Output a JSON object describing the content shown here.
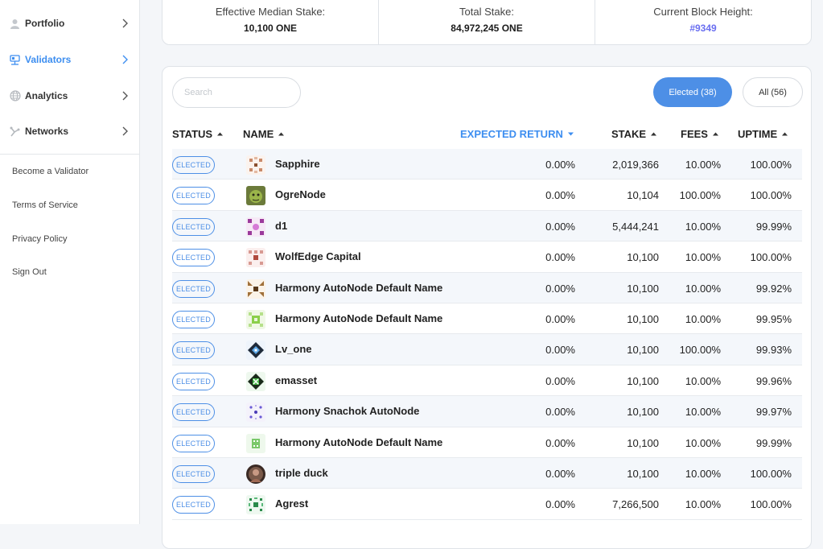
{
  "sidebar": {
    "nav": [
      {
        "label": "Portfolio",
        "icon": "user-icon",
        "active": false
      },
      {
        "label": "Validators",
        "icon": "validators-icon",
        "active": true
      },
      {
        "label": "Analytics",
        "icon": "globe-icon",
        "active": false
      },
      {
        "label": "Networks",
        "icon": "network-icon",
        "active": false
      }
    ],
    "links": [
      "Become a Validator",
      "Terms of Service",
      "Privacy Policy",
      "Sign Out"
    ]
  },
  "stats": {
    "median_label": "Effective Median Stake:",
    "median_value": "10,100 ONE",
    "total_label": "Total Stake:",
    "total_value": "84,972,245 ONE",
    "block_label": "Current Block Height:",
    "block_value": "#9349"
  },
  "table": {
    "search_placeholder": "Search",
    "filter_elected": "Elected (38)",
    "filter_all": "All (56)",
    "columns": {
      "status": "STATUS",
      "name": "NAME",
      "expected_return": "EXPECTED RETURN",
      "stake": "STAKE",
      "fees": "FEES",
      "uptime": "UPTIME"
    },
    "rows": [
      {
        "status": "ELECTED",
        "name": "Sapphire",
        "ret": "0.00%",
        "stake": "2,019,366",
        "fees": "10.00%",
        "uptime": "100.00%"
      },
      {
        "status": "ELECTED",
        "name": "OgreNode",
        "ret": "0.00%",
        "stake": "10,104",
        "fees": "100.00%",
        "uptime": "100.00%"
      },
      {
        "status": "ELECTED",
        "name": "d1",
        "ret": "0.00%",
        "stake": "5,444,241",
        "fees": "10.00%",
        "uptime": "99.99%"
      },
      {
        "status": "ELECTED",
        "name": "WolfEdge Capital",
        "ret": "0.00%",
        "stake": "10,100",
        "fees": "10.00%",
        "uptime": "100.00%"
      },
      {
        "status": "ELECTED",
        "name": "Harmony AutoNode Default Name",
        "ret": "0.00%",
        "stake": "10,100",
        "fees": "10.00%",
        "uptime": "99.92%"
      },
      {
        "status": "ELECTED",
        "name": "Harmony AutoNode Default Name",
        "ret": "0.00%",
        "stake": "10,100",
        "fees": "10.00%",
        "uptime": "99.95%"
      },
      {
        "status": "ELECTED",
        "name": "Lv_one",
        "ret": "0.00%",
        "stake": "10,100",
        "fees": "100.00%",
        "uptime": "99.93%"
      },
      {
        "status": "ELECTED",
        "name": "emasset",
        "ret": "0.00%",
        "stake": "10,100",
        "fees": "10.00%",
        "uptime": "99.96%"
      },
      {
        "status": "ELECTED",
        "name": "Harmony Snachok AutoNode",
        "ret": "0.00%",
        "stake": "10,100",
        "fees": "10.00%",
        "uptime": "99.97%"
      },
      {
        "status": "ELECTED",
        "name": "Harmony AutoNode Default Name",
        "ret": "0.00%",
        "stake": "10,100",
        "fees": "10.00%",
        "uptime": "99.99%"
      },
      {
        "status": "ELECTED",
        "name": "triple duck",
        "ret": "0.00%",
        "stake": "10,100",
        "fees": "10.00%",
        "uptime": "100.00%"
      },
      {
        "status": "ELECTED",
        "name": "Agrest",
        "ret": "0.00%",
        "stake": "7,266,500",
        "fees": "10.00%",
        "uptime": "100.00%"
      }
    ]
  },
  "colors": {
    "accent": "#4d8fe6",
    "link": "#6a6ff0"
  }
}
